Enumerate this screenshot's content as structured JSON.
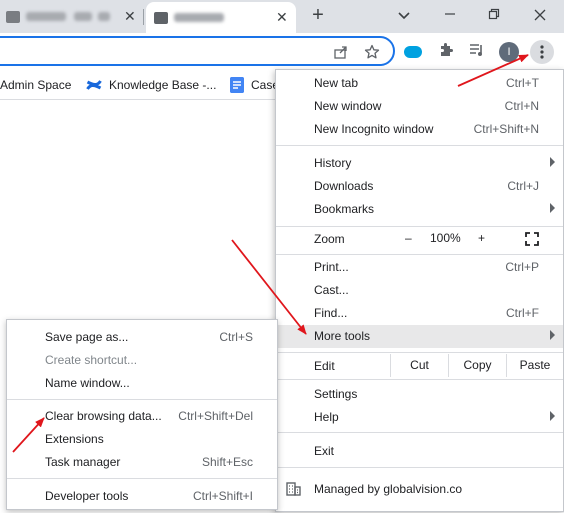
{
  "tabs": [
    {
      "title": "",
      "close_icon": "close-icon"
    },
    {
      "title": "",
      "close_icon": "close-icon"
    }
  ],
  "window_controls": {
    "new_tab": "+",
    "tab_search": "⌄",
    "minimize": "—",
    "restore": "⧉",
    "close": "✕"
  },
  "toolbar": {
    "profile_initial": "I",
    "menu_glyph": "⋮"
  },
  "bookmarks": [
    {
      "label": "Admin Space"
    },
    {
      "label": "Knowledge Base -..."
    },
    {
      "label": "Case"
    }
  ],
  "menu": {
    "new_tab": {
      "label": "New tab",
      "shortcut": "Ctrl+T"
    },
    "new_window": {
      "label": "New window",
      "shortcut": "Ctrl+N"
    },
    "new_incognito": {
      "label": "New Incognito window",
      "shortcut": "Ctrl+Shift+N"
    },
    "history": {
      "label": "History"
    },
    "downloads": {
      "label": "Downloads",
      "shortcut": "Ctrl+J"
    },
    "bookmarks": {
      "label": "Bookmarks"
    },
    "zoom": {
      "label": "Zoom",
      "minus": "–",
      "level": "100%",
      "plus": "+"
    },
    "print": {
      "label": "Print...",
      "shortcut": "Ctrl+P"
    },
    "cast": {
      "label": "Cast..."
    },
    "find": {
      "label": "Find...",
      "shortcut": "Ctrl+F"
    },
    "more_tools": {
      "label": "More tools"
    },
    "edit": {
      "label": "Edit",
      "cut": "Cut",
      "copy": "Copy",
      "paste": "Paste"
    },
    "settings": {
      "label": "Settings"
    },
    "help": {
      "label": "Help"
    },
    "exit": {
      "label": "Exit"
    },
    "managed": {
      "label": "Managed by globalvision.co"
    }
  },
  "more_tools_menu": {
    "save_page": {
      "label": "Save page as...",
      "shortcut": "Ctrl+S"
    },
    "create_shortcut": {
      "label": "Create shortcut..."
    },
    "name_window": {
      "label": "Name window..."
    },
    "clear_browsing": {
      "label": "Clear browsing data...",
      "shortcut": "Ctrl+Shift+Del"
    },
    "extensions": {
      "label": "Extensions"
    },
    "task_manager": {
      "label": "Task manager",
      "shortcut": "Shift+Esc"
    },
    "developer_tools": {
      "label": "Developer tools",
      "shortcut": "Ctrl+Shift+I"
    }
  },
  "colors": {
    "accent": "#1a73e8",
    "annotation_arrow": "#e0161c",
    "hover_row": "#e8e8e9"
  }
}
